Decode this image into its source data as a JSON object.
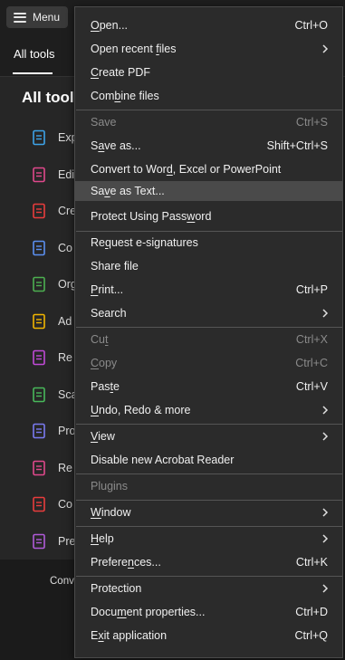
{
  "app": {
    "menu_button_label": "Menu",
    "tab_label": "All tools",
    "panel_title": "All tools",
    "tools": [
      {
        "label": "Exp",
        "icon": "export-pdf-icon",
        "color": "#3da3e8"
      },
      {
        "label": "Edi",
        "icon": "edit-pdf-icon",
        "color": "#e0488b"
      },
      {
        "label": "Cre",
        "icon": "create-pdf-icon",
        "color": "#e83c3c"
      },
      {
        "label": "Co",
        "icon": "combine-files-icon",
        "color": "#5a8ff0"
      },
      {
        "label": "Org",
        "icon": "organize-pages-icon",
        "color": "#4caf50"
      },
      {
        "label": "Ad",
        "icon": "add-comments-icon",
        "color": "#f0b400"
      },
      {
        "label": "Re",
        "icon": "request-signatures-icon",
        "color": "#c04ad6"
      },
      {
        "label": "Sca",
        "icon": "scan-ocr-icon",
        "color": "#48b85a"
      },
      {
        "label": "Pro",
        "icon": "protect-pdf-icon",
        "color": "#7a7af0"
      },
      {
        "label": "Re",
        "icon": "redact-icon",
        "color": "#e0488b"
      },
      {
        "label": "Co",
        "icon": "compress-pdf-icon",
        "color": "#e83c3c"
      },
      {
        "label": "Pre",
        "icon": "prepare-form-icon",
        "color": "#b05ad8"
      }
    ],
    "footer_text": "Conve"
  },
  "menu": {
    "items": [
      {
        "name": "open",
        "label": "Open...",
        "shortcut": "Ctrl+O",
        "mnemonic": "O"
      },
      {
        "name": "open-recent-files",
        "label": "Open recent files",
        "submenu": true,
        "mnemonic": "f"
      },
      {
        "name": "create-pdf",
        "label": "Create PDF",
        "mnemonic": "C"
      },
      {
        "name": "combine-files",
        "label": "Combine files",
        "mnemonic": "b"
      },
      {
        "name": "save",
        "label": "Save",
        "shortcut": "Ctrl+S",
        "disabled": true
      },
      {
        "name": "save-as",
        "label": "Save as...",
        "shortcut": "Shift+Ctrl+S",
        "mnemonic": "a"
      },
      {
        "name": "convert",
        "label": "Convert to Word, Excel or PowerPoint",
        "mnemonic": "d"
      },
      {
        "name": "save-as-text",
        "label": "Save as Text...",
        "mnemonic": "v",
        "highlighted": true
      },
      {
        "name": "protect-password",
        "label": "Protect Using Password",
        "mnemonic": "w"
      },
      {
        "name": "request-esignatures",
        "label": "Request e-signatures",
        "mnemonic": "q"
      },
      {
        "name": "share-file",
        "label": "Share file"
      },
      {
        "name": "print",
        "label": "Print...",
        "shortcut": "Ctrl+P",
        "mnemonic": "P"
      },
      {
        "name": "search",
        "label": "Search",
        "submenu": true
      },
      {
        "name": "cut",
        "label": "Cut",
        "shortcut": "Ctrl+X",
        "disabled": true,
        "mnemonic": "t"
      },
      {
        "name": "copy",
        "label": "Copy",
        "shortcut": "Ctrl+C",
        "disabled": true,
        "mnemonic": "C"
      },
      {
        "name": "paste",
        "label": "Paste",
        "shortcut": "Ctrl+V",
        "mnemonic": "t"
      },
      {
        "name": "undo-redo-more",
        "label": "Undo, Redo & more",
        "submenu": true,
        "mnemonic": "U"
      },
      {
        "name": "view",
        "label": "View",
        "submenu": true,
        "mnemonic": "V"
      },
      {
        "name": "disable-new-reader",
        "label": "Disable new Acrobat Reader"
      },
      {
        "name": "plugins",
        "label": "Plugins",
        "disabled": true
      },
      {
        "name": "window",
        "label": "Window",
        "submenu": true,
        "mnemonic": "W"
      },
      {
        "name": "help",
        "label": "Help",
        "submenu": true,
        "mnemonic": "H"
      },
      {
        "name": "preferences",
        "label": "Preferences...",
        "shortcut": "Ctrl+K",
        "mnemonic": "n"
      },
      {
        "name": "protection",
        "label": "Protection",
        "submenu": true
      },
      {
        "name": "document-properties",
        "label": "Document properties...",
        "shortcut": "Ctrl+D",
        "mnemonic": "m"
      },
      {
        "name": "exit-application",
        "label": "Exit application",
        "shortcut": "Ctrl+Q",
        "mnemonic": "x"
      }
    ]
  }
}
